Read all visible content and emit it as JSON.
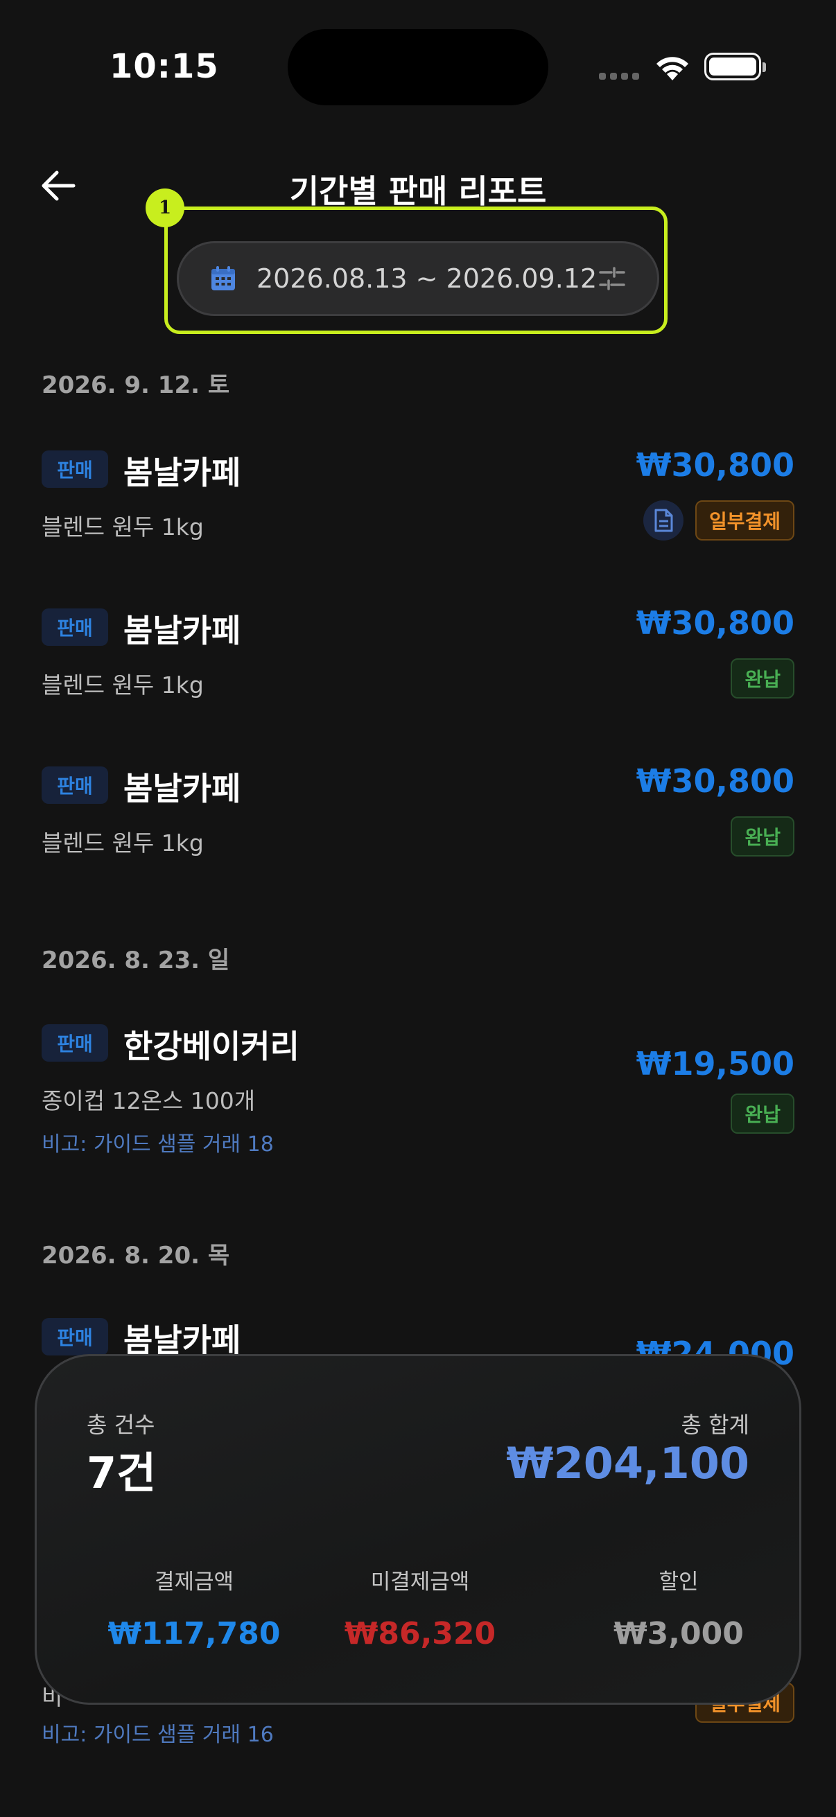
{
  "status_bar": {
    "time": "10:15"
  },
  "header": {
    "title": "기간별 판매 리포트",
    "date_range": "2026.08.13 ~ 2026.09.12",
    "annotation_marker": "1"
  },
  "groups": [
    {
      "date": "2026. 9. 12. 토",
      "entries": [
        {
          "type": "판매",
          "store": "봄날카페",
          "item": "블렌드 원두 1kg",
          "amount": "₩30,800",
          "status": "일부결제"
        },
        {
          "type": "판매",
          "store": "봄날카페",
          "item": "블렌드 원두 1kg",
          "amount": "₩30,800",
          "status": "완납"
        },
        {
          "type": "판매",
          "store": "봄날카페",
          "item": "블렌드 원두 1kg",
          "amount": "₩30,800",
          "status": "완납"
        }
      ]
    },
    {
      "date": "2026. 8. 23. 일",
      "entries": [
        {
          "type": "판매",
          "store": "한강베이커리",
          "item": "종이컵 12온스 100개",
          "memo": "비고: 가이드 샘플 거래 18",
          "amount": "₩19,500",
          "status": "완납"
        }
      ]
    },
    {
      "date": "2026. 8. 20. 목",
      "entries": [
        {
          "type": "판매",
          "store": "봄날카페",
          "item": "",
          "memo": "비고: 가이드 샘플 거래 16",
          "amount": "₩24,000",
          "status": "일부결제"
        }
      ]
    }
  ],
  "summary": {
    "count_label": "총 건수",
    "count_value": "7건",
    "total_label": "총 합계",
    "total_value": "₩204,100",
    "paid_label": "결제금액",
    "paid_value": "₩117,780",
    "unpaid_label": "미결제금액",
    "unpaid_value": "₩86,320",
    "discount_label": "할인",
    "discount_value": "₩3,000"
  },
  "colors": {
    "background": "#131313",
    "highlight": "#c8ee1e",
    "amount_blue": "#1c7de6",
    "total_blue": "#5e8de3",
    "unpaid_red": "#c62828",
    "partial_orange": "#f3932a",
    "paid_green": "#49b054"
  },
  "icons": [
    "back-arrow-icon",
    "calendar-icon",
    "filter-sliders-icon",
    "document-icon",
    "wifi-icon",
    "battery-icon"
  ]
}
